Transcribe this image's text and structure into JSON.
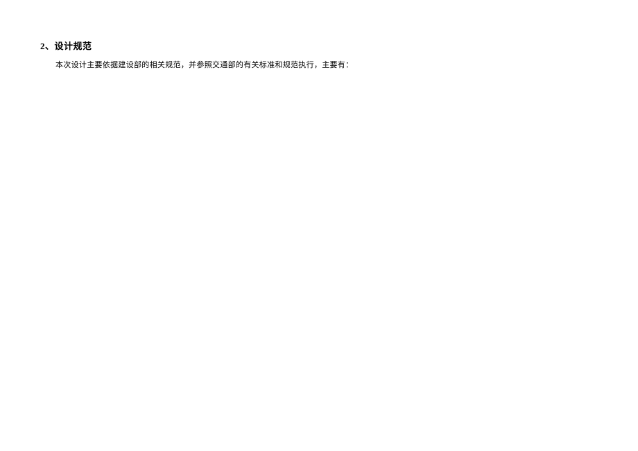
{
  "document": {
    "heading": "2、设计规范",
    "paragraph": "本次设计主要依据建设部的相关规范，并参照交通部的有关标准和规范执行，主要有："
  }
}
